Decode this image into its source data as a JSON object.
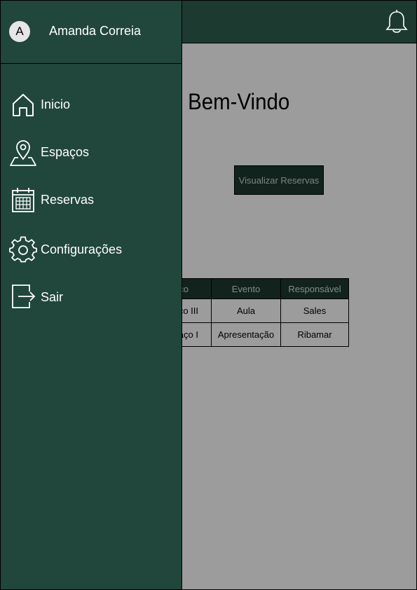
{
  "main": {
    "welcome_text": "Seja Bem-Vindo",
    "view_reservations_button": "Visualizar Reservas",
    "table": {
      "headers": [
        "Espaço",
        "Evento",
        "Responsável"
      ],
      "rows": [
        [
          "Espaço III",
          "Aula",
          "Sales"
        ],
        [
          "Espaço I",
          "Apresentação",
          "Ribamar"
        ]
      ]
    }
  },
  "header": {
    "notifications_icon": "bell-icon"
  },
  "drawer": {
    "user": {
      "initial": "A",
      "name": "Amanda Correia"
    },
    "items": [
      {
        "label": "Inicio",
        "icon": "home-icon"
      },
      {
        "label": "Espaços",
        "icon": "map-pin-icon"
      },
      {
        "label": "Reservas",
        "icon": "calendar-icon"
      },
      {
        "label": "Configurações",
        "icon": "gear-icon"
      },
      {
        "label": "Sair",
        "icon": "logout-icon"
      }
    ]
  },
  "colors": {
    "dark_green": "#1c3a2f",
    "drawer_green": "#21463c",
    "overlay": "#9a9a9a"
  }
}
